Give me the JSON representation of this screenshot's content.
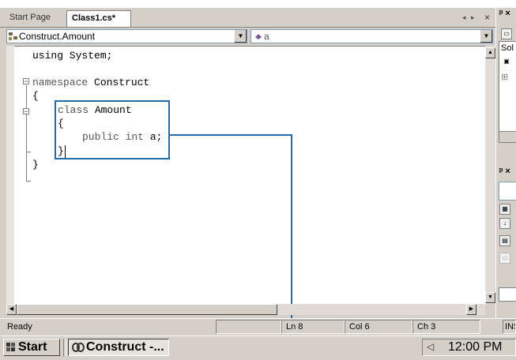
{
  "tabs": [
    {
      "label": "Start Page"
    },
    {
      "label": "Class1.cs*"
    }
  ],
  "tab_controls": {
    "nav": "◂ ▸",
    "close": "×"
  },
  "nav_bar": {
    "type_combo": "Construct.Amount",
    "member_combo": "a"
  },
  "code_lines": [
    {
      "text": "using System;"
    },
    {
      "kw": "namespace",
      "rest": " Construct"
    },
    {
      "text": "{"
    },
    {
      "kw": "class",
      "rest": " Amount"
    },
    {
      "text": "{"
    },
    {
      "kw": "public int",
      "rest": " a;"
    },
    {
      "text": "}"
    },
    {
      "text": "}"
    }
  ],
  "status": {
    "message": "Ready",
    "line": "Ln 8",
    "column": "Col 6",
    "char": "Ch 3",
    "mode": "INS"
  },
  "taskbar": {
    "start_label": "Start",
    "task_label": "Construct -...",
    "clock": "12:00 PM"
  },
  "right_panel": {
    "solution_label": "Sol",
    "pin_glyph": "ᵖ ×"
  }
}
